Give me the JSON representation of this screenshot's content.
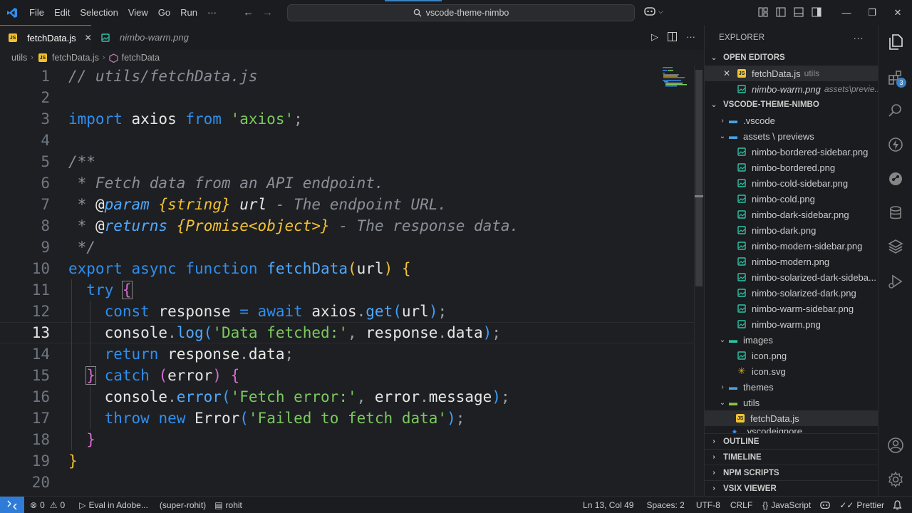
{
  "titlebar": {
    "menu": [
      "File",
      "Edit",
      "Selection",
      "View",
      "Go",
      "Run",
      "···"
    ],
    "search_text": "vscode-theme-nimbo"
  },
  "tabs": [
    {
      "label": "fetchData.js",
      "icon": "js-icon",
      "active": true
    },
    {
      "label": "nimbo-warm.png",
      "icon": "image-icon",
      "active": false
    }
  ],
  "breadcrumb": [
    "utils",
    "fetchData.js",
    "fetchData"
  ],
  "editor": {
    "current_line": 13,
    "line_numbers": [
      "1",
      "2",
      "3",
      "4",
      "5",
      "6",
      "7",
      "8",
      "9",
      "10",
      "11",
      "12",
      "13",
      "14",
      "15",
      "16",
      "17",
      "18",
      "19",
      "20"
    ]
  },
  "explorer": {
    "title": "EXPLORER",
    "open_editors_title": "OPEN EDITORS",
    "open_editors": [
      {
        "name": "fetchData.js",
        "desc": "utils"
      },
      {
        "name": "nimbo-warm.png",
        "desc": "assets\\previe..."
      }
    ],
    "root_title": "VSCODE-THEME-NIMBO",
    "tree": [
      {
        "name": ".vscode",
        "type": "folder",
        "depth": 0,
        "expanded": false
      },
      {
        "name": "assets \\ previews",
        "type": "folder",
        "depth": 0,
        "expanded": true
      },
      {
        "name": "nimbo-bordered-sidebar.png",
        "type": "png",
        "depth": 1
      },
      {
        "name": "nimbo-bordered.png",
        "type": "png",
        "depth": 1
      },
      {
        "name": "nimbo-cold-sidebar.png",
        "type": "png",
        "depth": 1
      },
      {
        "name": "nimbo-cold.png",
        "type": "png",
        "depth": 1
      },
      {
        "name": "nimbo-dark-sidebar.png",
        "type": "png",
        "depth": 1
      },
      {
        "name": "nimbo-dark.png",
        "type": "png",
        "depth": 1
      },
      {
        "name": "nimbo-modern-sidebar.png",
        "type": "png",
        "depth": 1
      },
      {
        "name": "nimbo-modern.png",
        "type": "png",
        "depth": 1
      },
      {
        "name": "nimbo-solarized-dark-sideba...",
        "type": "png",
        "depth": 1
      },
      {
        "name": "nimbo-solarized-dark.png",
        "type": "png",
        "depth": 1
      },
      {
        "name": "nimbo-warm-sidebar.png",
        "type": "png",
        "depth": 1
      },
      {
        "name": "nimbo-warm.png",
        "type": "png",
        "depth": 1
      },
      {
        "name": "images",
        "type": "folder",
        "depth": 0,
        "expanded": true
      },
      {
        "name": "icon.png",
        "type": "png",
        "depth": 1
      },
      {
        "name": "icon.svg",
        "type": "svg",
        "depth": 1
      },
      {
        "name": "themes",
        "type": "folder",
        "depth": 0,
        "expanded": false
      },
      {
        "name": "utils",
        "type": "folder",
        "depth": 0,
        "expanded": true
      },
      {
        "name": "fetchData.js",
        "type": "js",
        "depth": 1,
        "selected": true
      },
      {
        "name": ".vscodeignore",
        "type": "file",
        "depth": 0
      }
    ],
    "sections": [
      "OUTLINE",
      "TIMELINE",
      "NPM SCRIPTS",
      "VSIX VIEWER"
    ]
  },
  "activity_badge": "3",
  "statusbar": {
    "errors": "0",
    "warnings": "0",
    "eval": "Eval in Adobe...",
    "profile": "(super-rohit)",
    "user": "rohit",
    "position": "Ln 13, Col 49",
    "spaces": "Spaces: 2",
    "encoding": "UTF-8",
    "eol": "CRLF",
    "language": "JavaScript",
    "formatter": "Prettier"
  },
  "colors": {
    "accent": "#3b82c4",
    "keyword": "#2f8fef",
    "string": "#7bc95f",
    "type": "#f1c232",
    "bracket_magenta": "#d96cd1"
  }
}
